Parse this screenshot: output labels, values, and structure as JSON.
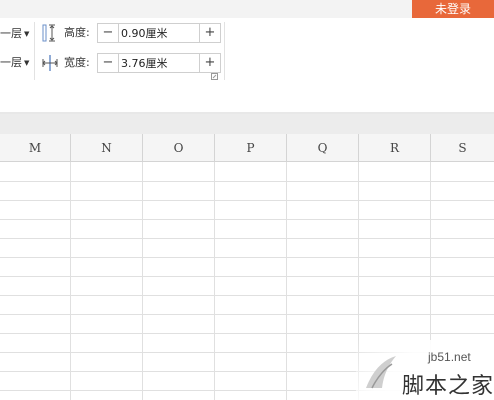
{
  "header": {
    "login_label": "未登录"
  },
  "arrange": {
    "bring_forward_label": "一层",
    "send_backward_label": "一层"
  },
  "size": {
    "height_label": "高度:",
    "height_value": "0.90厘米",
    "width_label": "宽度:",
    "width_value": "3.76厘米",
    "minus_symbol": "−",
    "plus_symbol": "+"
  },
  "sheet": {
    "columns": [
      "M",
      "N",
      "O",
      "P",
      "Q",
      "R",
      "S"
    ]
  },
  "watermark": {
    "url": "jb51.net",
    "name": "脚本之家"
  },
  "colors": {
    "login_bg": "#e8683a",
    "ribbon_bg": "#ffffff",
    "grid_line": "#e0e0e0"
  }
}
